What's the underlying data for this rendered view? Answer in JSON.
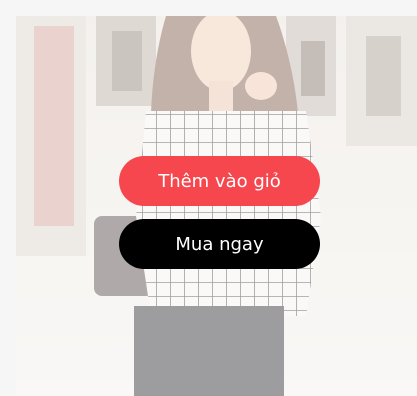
{
  "product": {
    "image_alt": "woman in checked blouse and black pants",
    "actions": {
      "add_to_cart_label": "Thêm vào giỏ",
      "buy_now_label": "Mua ngay"
    }
  },
  "colors": {
    "add_to_cart": "#f6474e",
    "buy_now": "#000000",
    "page_background": "#f6f6f6"
  }
}
